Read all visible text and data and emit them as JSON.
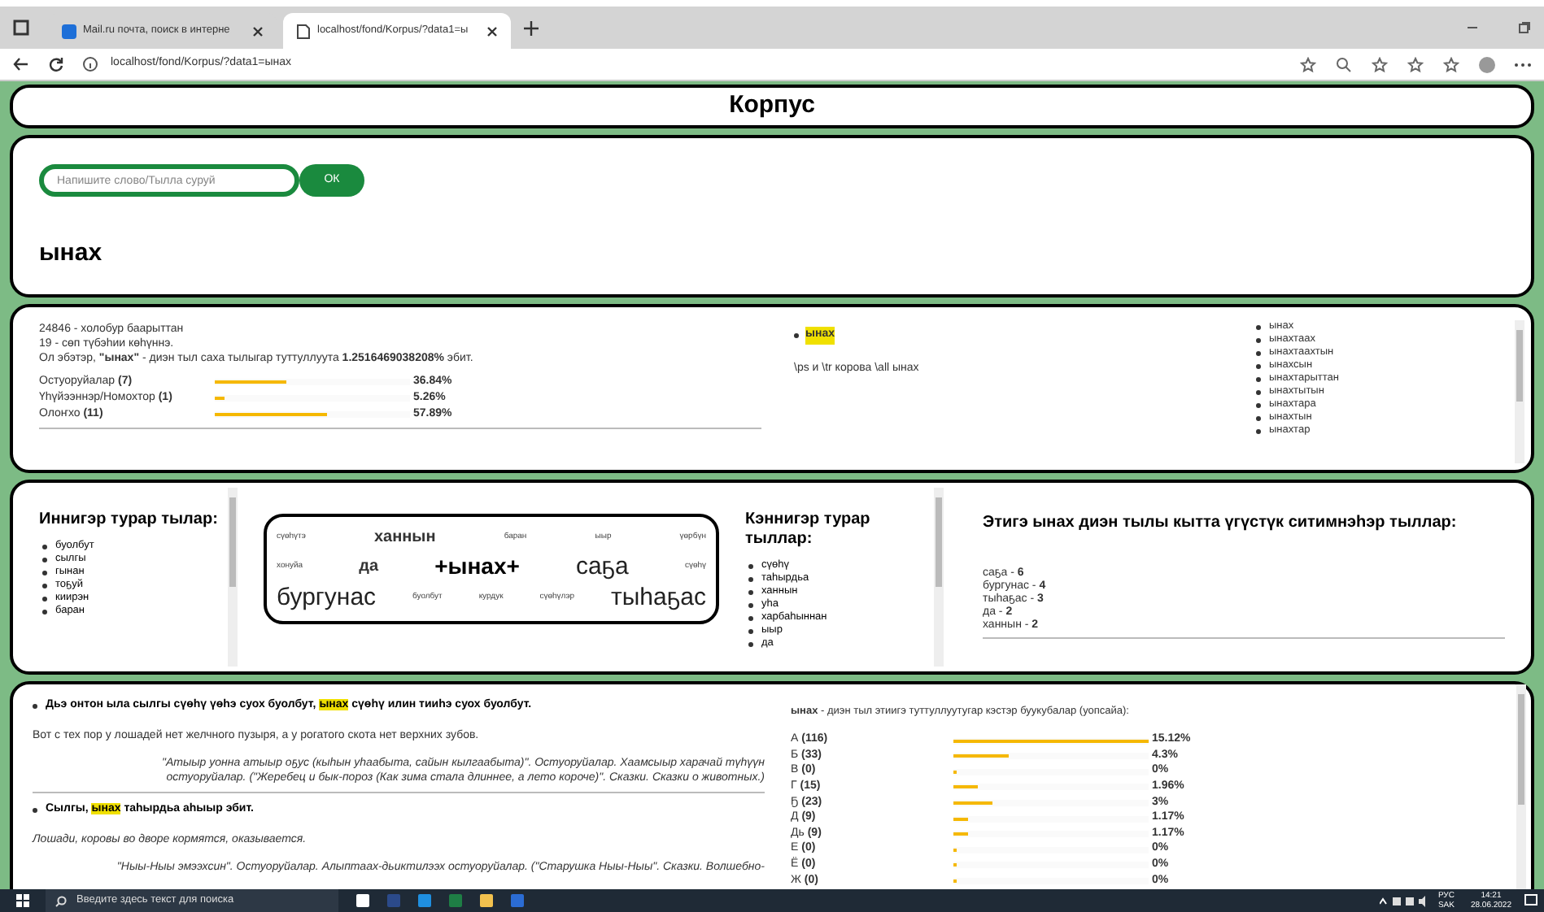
{
  "browser": {
    "tabs": [
      {
        "title": "Mail.ru почта, поиск в интерне",
        "selected": false
      },
      {
        "title": "localhost/fond/Korpus/?data1=ы",
        "selected": true
      }
    ],
    "address": "localhost/fond/Korpus/?data1=ынах"
  },
  "header": {
    "title": "Корпус"
  },
  "search": {
    "placeholder": "Напишите слово/Тылла суруй",
    "button": "ОК",
    "word": "ынах"
  },
  "stats": {
    "lines": [
      "24846 - холобур баарыттан",
      "19 - сөп түбэһии көһүннэ.",
      "Ол эбэтэр, **\"ынах\"** - диэн тыл саха тылыгар туттуллуута **1.2516469038208%** эбит."
    ],
    "genres": [
      {
        "name": "Остуоруйалар",
        "count": "(7)",
        "level": 0.3684,
        "percent": "36.84%"
      },
      {
        "name": "Үһүйээннэр/Номохтор",
        "count": "(1)",
        "level": 0.0526,
        "percent": "5.26%"
      },
      {
        "name": "Олоҥхо",
        "count": "(11)",
        "level": 0.5789,
        "percent": "57.89%"
      }
    ],
    "entry": {
      "word": "ынах",
      "gloss": "\\ps и \\tr корова \\all ынах"
    },
    "forms": [
      "ынах",
      "ынахтаах",
      "ынахтаахтын",
      "ынахсын",
      "ынахтарыттан",
      "ынахтытын",
      "ынахтара",
      "ынахтын",
      "ынахтар"
    ]
  },
  "context": {
    "before": {
      "title": "Иннигэр турар тылар:",
      "words": [
        "буолбут",
        "сылгы",
        "гынан",
        "тоҕуй",
        "киирэн",
        "баран"
      ]
    },
    "cloud": [
      {
        "text": "сүөһүтэ",
        "kind": "small"
      },
      {
        "text": "ханнын",
        "kind": "medium"
      },
      {
        "text": "баран",
        "kind": "small"
      },
      {
        "text": "ыыр",
        "kind": "small"
      },
      {
        "text": "үөрбүн",
        "kind": "small"
      },
      {
        "text": "хонуйа",
        "kind": "small"
      },
      {
        "text": "да",
        "kind": "medium"
      },
      {
        "text": "+ынах+",
        "kind": "center"
      },
      {
        "text": "саҕа",
        "kind": "large"
      },
      {
        "text": "сүөһү",
        "kind": "small"
      },
      {
        "text": "бургунас",
        "kind": "large"
      },
      {
        "text": "буолбут",
        "kind": "small"
      },
      {
        "text": "курдук",
        "kind": "small"
      },
      {
        "text": "сүөһүлэр",
        "kind": "small"
      },
      {
        "text": "тыһаҕас",
        "kind": "large"
      }
    ],
    "after": {
      "title": "Кэннигэр турар тыллар:",
      "words": [
        "сүөһү",
        "таһырдьа",
        "ханнын",
        "уһа",
        "харбаһыннан",
        "ыыр",
        "да"
      ]
    },
    "frequent": {
      "title": "Этигэ ынах диэн тылы кытта үгүстүк ситимнэһэр тыллар:",
      "items": [
        {
          "word": "саҕа",
          "separator": "-",
          "count": "6"
        },
        {
          "word": "бургунас",
          "separator": "-",
          "count": "4"
        },
        {
          "word": "тыһаҕас",
          "separator": "-",
          "count": "3"
        },
        {
          "word": "да",
          "separator": "-",
          "count": "2"
        },
        {
          "word": "ханнын",
          "separator": "-",
          "count": "2"
        }
      ]
    }
  },
  "examples": {
    "sentences": [
      {
        "before": "Дьэ онтон ыла сылгы сүөһү үөһэ суох буолбут, ",
        "match": "ынах",
        "after": " сүөһү илин тииһэ суох буолбут.",
        "translation": "Вот с тех пор у лошадей нет желчного пузыря, а у рогатого скота нет верхних зубов.",
        "source": "\"Атыыр уонна атыыр оҕус (кыһын уһаабыта, сайын кылгаабыта)\". Остуоруйалар. Хаамсыыр харачай түһүүн остуоруйалар. (\"Жеребец и бык-пороз (Как зима стала длиннее, а лето короче)\". Сказки. Сказки о животных.)"
      },
      {
        "before": "Сылгы, ",
        "match": "ынах",
        "after": " таһырдьа аһыыр эбит.",
        "translation": "Лошади, коровы во дворе кормятся, оказывается.",
        "source": "\"Ныы-Ныы эмээхсин\". Остуоруйалар. Алыптаах-дьиктилээх остуоруйалар. (\"Старушка Ныы-Ныы\". Сказки. Волшебно-"
      }
    ],
    "letters": {
      "caption": "**ынах** - диэн тыл этиигэ туттуллуутугар кэстэр буукубалар (уопсайа):",
      "rows": [
        {
          "letter": "А",
          "count": "(116)",
          "level": 1,
          "percent": "15.12%"
        },
        {
          "letter": "Б",
          "count": "(33)",
          "level": 0.284,
          "percent": "4.3%"
        },
        {
          "letter": "В",
          "count": "(0)",
          "level": 0,
          "percent": "0%"
        },
        {
          "letter": "Г",
          "count": "(15)",
          "level": 0.129,
          "percent": "1.96%"
        },
        {
          "letter": "Ҕ",
          "count": "(23)",
          "level": 0.198,
          "percent": "3%"
        },
        {
          "letter": "Д",
          "count": "(9)",
          "level": 0.078,
          "percent": "1.17%"
        },
        {
          "letter": "Дь",
          "count": "(9)",
          "level": 0.078,
          "percent": "1.17%"
        },
        {
          "letter": "Е",
          "count": "(0)",
          "level": 0,
          "percent": "0%"
        },
        {
          "letter": "Ё",
          "count": "(0)",
          "level": 0,
          "percent": "0%"
        },
        {
          "letter": "Ж",
          "count": "(0)",
          "level": 0,
          "percent": "0%"
        }
      ]
    }
  },
  "taskbar": {
    "search_placeholder": "Введите здесь текст для поиска",
    "lang": "РУС",
    "layout": "SAK",
    "time": "14:21",
    "date": "28.06.2022"
  }
}
